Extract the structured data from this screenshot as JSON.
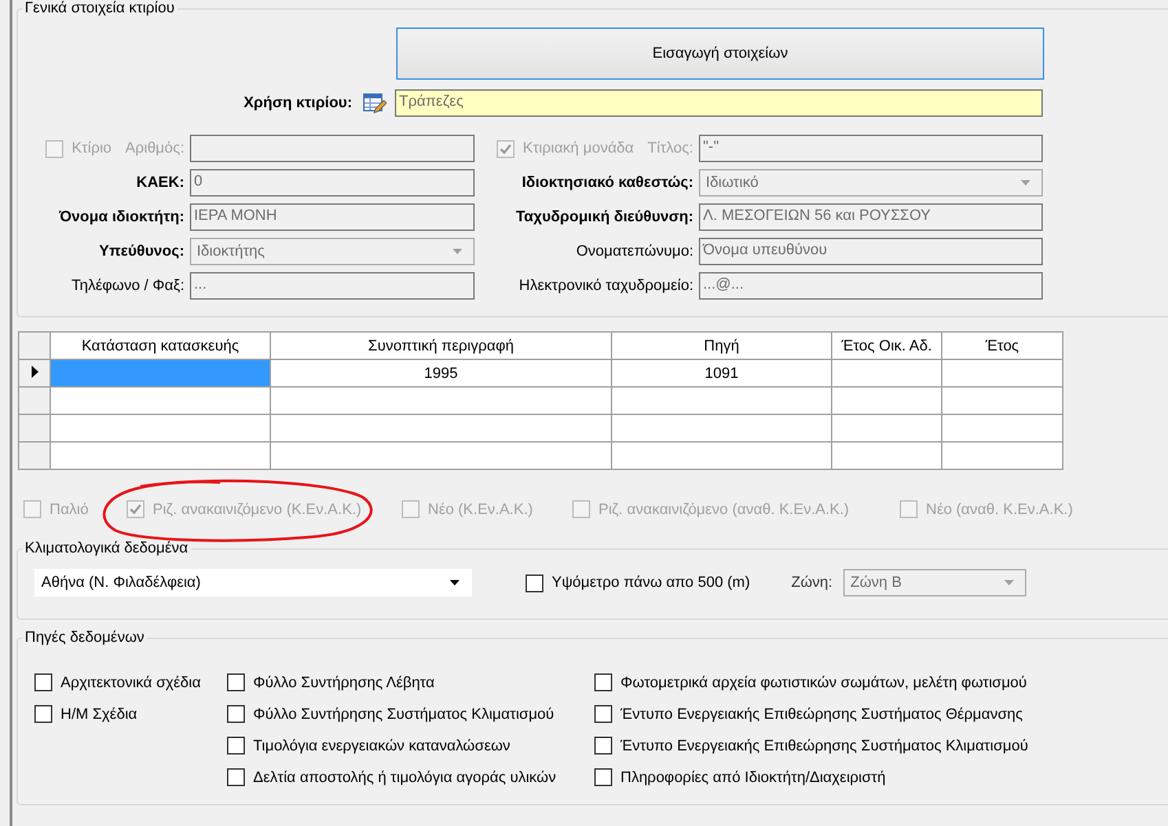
{
  "general": {
    "title": "Γενικά στοιχεία κτιρίου",
    "enter_button": "Εισαγωγή στοιχείων",
    "building_use": {
      "label": "Χρήση κτιρίου:",
      "value": "Τράπεζες"
    },
    "rows": [
      [
        {
          "kind": "check",
          "check_label": "Κτίριο",
          "checked": false,
          "label": "Αριθμός:",
          "bold": false,
          "disabled": true
        },
        {
          "kind": "check",
          "check_label": "Κτιριακή μονάδα",
          "checked": true,
          "label": "Τίτλος:",
          "bold": false,
          "disabled": true,
          "value": "\"-\""
        }
      ],
      [
        {
          "kind": "text",
          "label": "ΚΑΕΚ:",
          "bold": true,
          "disabled": false,
          "value": "0"
        },
        {
          "kind": "combo",
          "label": "Ιδιοκτησιακό καθεστώς:",
          "bold": true,
          "disabled": false,
          "value": "Ιδιωτικό"
        }
      ],
      [
        {
          "kind": "text",
          "label": "Όνομα ιδιοκτήτη:",
          "bold": true,
          "disabled": false,
          "value": "ΙΕΡΑ ΜΟΝΗ"
        },
        {
          "kind": "text",
          "label": "Ταχυδρομική διεύθυνση:",
          "bold": true,
          "disabled": false,
          "value": "Λ. ΜΕΣΟΓΕΙΩΝ 56 και ΡΟΥΣΣΟΥ"
        }
      ],
      [
        {
          "kind": "combo",
          "label": "Υπεύθυνος:",
          "bold": true,
          "disabled": false,
          "value": "Ιδιοκτήτης"
        },
        {
          "kind": "text",
          "label": "Ονοματεπώνυμο:",
          "bold": false,
          "disabled": false,
          "value": "Όνομα υπευθύνου"
        }
      ],
      [
        {
          "kind": "text",
          "label": "Τηλέφωνο / Φαξ:",
          "bold": false,
          "disabled": false,
          "value": "..."
        },
        {
          "kind": "text",
          "label": "Ηλεκτρονικό ταχυδρομείο:",
          "bold": false,
          "disabled": false,
          "value": "...@..."
        }
      ]
    ]
  },
  "table": {
    "columns": [
      "Κατάσταση κατασκευής",
      "Συνοπτική περιγραφή",
      "Πηγή",
      "Έτος Οικ. Αδ.",
      "Έτος"
    ],
    "rows": [
      {
        "current": true,
        "cells": [
          {
            "selected": true
          },
          {
            "selected": false,
            "text": "1995"
          },
          {
            "selected": false,
            "text": "1091"
          },
          {
            "selected": false
          },
          {
            "selected": false
          }
        ]
      },
      {
        "current": false,
        "cells": [
          {
            "selected": false
          },
          {
            "selected": false
          },
          {
            "selected": false
          },
          {
            "selected": false
          },
          {
            "selected": false
          }
        ]
      },
      {
        "current": false,
        "cells": [
          {
            "selected": false
          },
          {
            "selected": false
          },
          {
            "selected": false
          },
          {
            "selected": false
          },
          {
            "selected": false
          }
        ]
      },
      {
        "current": false,
        "cells": [
          {
            "selected": false
          },
          {
            "selected": false
          },
          {
            "selected": false
          },
          {
            "selected": false
          },
          {
            "selected": false
          }
        ]
      }
    ]
  },
  "construction_status": [
    {
      "label": "Παλιό",
      "checked": false
    },
    {
      "label": "Ριζ. ανακαινιζόμενο (Κ.Εν.Α.Κ.)",
      "checked": true
    },
    {
      "label": "Νέο (Κ.Εν.Α.Κ.)",
      "checked": false
    },
    {
      "label": "Ριζ. ανακαινιζόμενο (αναθ.  Κ.Εν.Α.Κ.)",
      "checked": false
    },
    {
      "label": "Νέο (αναθ. Κ.Εν.Α.Κ.)",
      "checked": false
    }
  ],
  "climate": {
    "title": "Κλιματολογικά δεδομένα",
    "location": "Αθήνα (Ν. Φιλαδέλφεια)",
    "altitude": {
      "label": "Υψόμετρο πάνω απο 500 (m)",
      "checked": false
    },
    "zone_label": "Ζώνη:",
    "zone": "Ζώνη Β"
  },
  "sources": {
    "title": "Πηγές δεδομένων",
    "columns": [
      [
        {
          "label": "Αρχιτεκτονικά σχέδια",
          "checked": false
        },
        {
          "label": "Η/Μ Σχέδια",
          "checked": false
        }
      ],
      [
        {
          "label": "Φύλλο Συντήρησης Λέβητα",
          "checked": false
        },
        {
          "label": "Φύλλο Συντήρησης Συστήματος Κλιματισμού",
          "checked": false
        },
        {
          "label": "Τιμολόγια ενεργειακών καταναλώσεων",
          "checked": false
        },
        {
          "label": "Δελτία αποστολής ή τιμολόγια αγοράς υλικών",
          "checked": false
        }
      ],
      [
        {
          "label": "Φωτομετρικά αρχεία φωτιστικών σωμάτων, μελέτη φωτισμού",
          "checked": false
        },
        {
          "label": "Έντυπο Ενεργειακής Επιθεώρησης Συστήματος Θέρμανσης",
          "checked": false
        },
        {
          "label": "Έντυπο Ενεργειακής Επιθεώρησης Συστήματος Κλιματισμού",
          "checked": false
        },
        {
          "label": "Πληροφορίες από Ιδιοκτήτη/Διαχειριστή",
          "checked": false
        }
      ]
    ]
  }
}
